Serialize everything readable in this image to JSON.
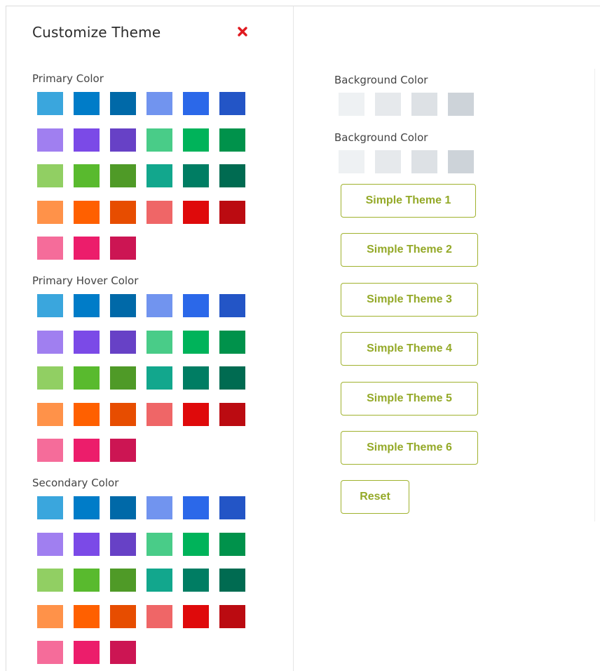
{
  "panel": {
    "title": "Customize Theme",
    "close_icon": "close-icon",
    "close_color": "#e0191f"
  },
  "palette": [
    "#3aa6dd",
    "#007cc8",
    "#0069a8",
    "#7194ef",
    "#2b68e9",
    "#2355c6",
    "#a07ff0",
    "#7b4ae7",
    "#6741c6",
    "#49cc88",
    "#00b35a",
    "#00924b",
    "#91cf63",
    "#59ba2e",
    "#4f9a27",
    "#12a78d",
    "#007d63",
    "#006b51",
    "#ff9249",
    "#ff6000",
    "#e74d00",
    "#ef6667",
    "#df0a0b",
    "#bb0b11",
    "#f56c9a",
    "#ec1d6b",
    "#cc1553"
  ],
  "sections": {
    "primary": {
      "label": "Primary Color"
    },
    "primary_hover": {
      "label": "Primary Hover Color"
    },
    "secondary": {
      "label": "Secondary Color"
    }
  },
  "background": {
    "label_1": "Background Color",
    "label_2": "Background Color",
    "swatches": [
      "#eef1f3",
      "#e6e9ec",
      "#dde1e5",
      "#cdd3d9"
    ]
  },
  "themes": {
    "theme_1": "Simple Theme 1",
    "theme_2": "Simple Theme 2",
    "theme_3": "Simple Theme 3",
    "theme_4": "Simple Theme 4",
    "theme_5": "Simple Theme 5",
    "theme_6": "Simple Theme 6",
    "reset": "Reset",
    "accent": "#a0b22e"
  }
}
